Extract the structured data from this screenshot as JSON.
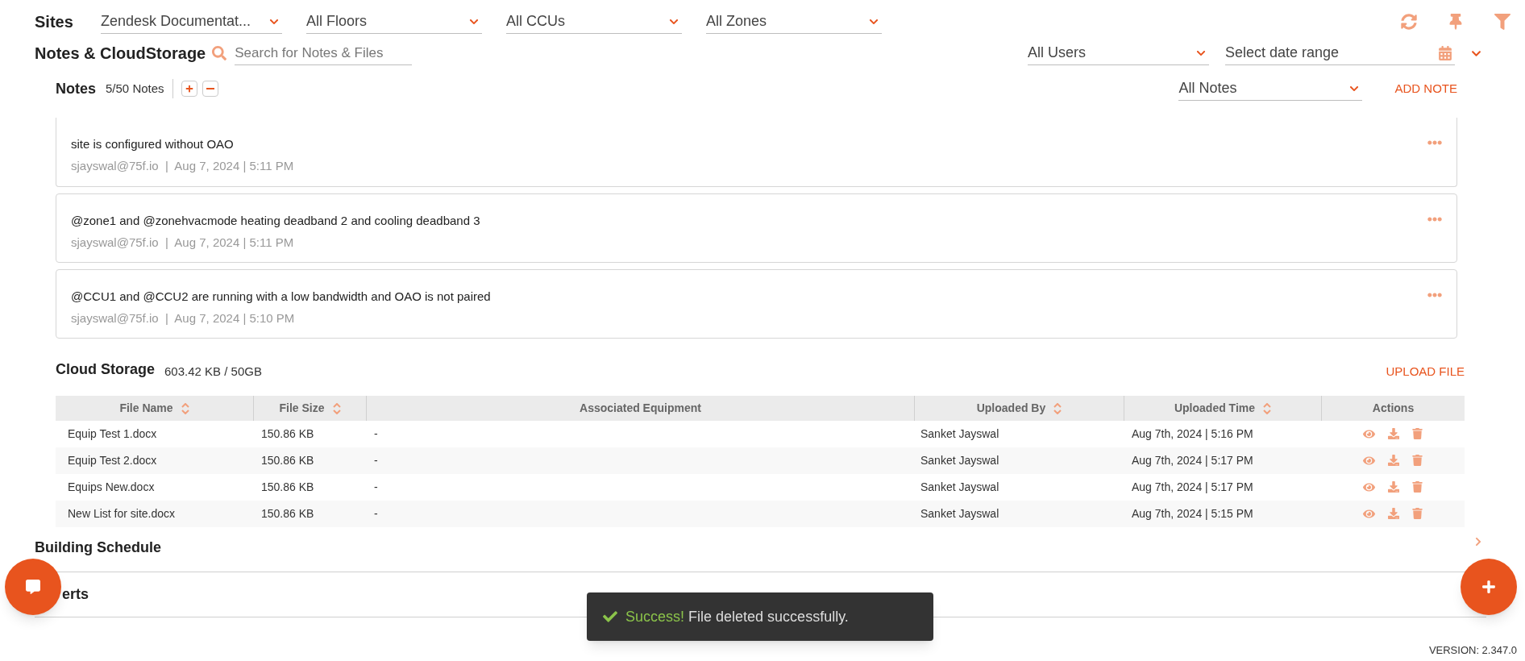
{
  "filters": {
    "title": "Sites",
    "dropdowns": [
      {
        "value": "Zendesk Documentat..."
      },
      {
        "value": "All Floors"
      },
      {
        "value": "All CCUs"
      },
      {
        "value": "All Zones"
      }
    ]
  },
  "notes_storage": {
    "title": "Notes & CloudStorage",
    "search": {
      "placeholder": "Search for Notes & Files"
    },
    "user_filter": {
      "value": "All Users"
    },
    "date_range": {
      "placeholder": "Select date range"
    }
  },
  "notes": {
    "title": "Notes",
    "count": "5/50 Notes",
    "filter": {
      "value": "All Notes"
    },
    "add_button": "ADD NOTE",
    "items": [
      {
        "text": "site is configured without OAO",
        "author": "sjayswal@75f.io",
        "separator": "|",
        "time": "Aug 7, 2024 | 5:11 PM"
      },
      {
        "text": "@zone1 and @zonehvacmode heating deadband 2 and cooling deadband 3",
        "author": "sjayswal@75f.io",
        "separator": "|",
        "time": "Aug 7, 2024 | 5:11 PM"
      },
      {
        "text": "@CCU1 and @CCU2 are running with a low bandwidth and OAO is not paired",
        "author": "sjayswal@75f.io",
        "separator": "|",
        "time": "Aug 7, 2024 | 5:10 PM"
      }
    ]
  },
  "cloud_storage": {
    "title": "Cloud Storage",
    "usage": "603.42 KB / 50GB",
    "upload_button": "UPLOAD FILE",
    "columns": [
      {
        "label": "File Name",
        "sortable": true
      },
      {
        "label": "File Size",
        "sortable": true
      },
      {
        "label": "Associated Equipment",
        "sortable": false
      },
      {
        "label": "Uploaded By",
        "sortable": true
      },
      {
        "label": "Uploaded Time",
        "sortable": true
      },
      {
        "label": "Actions",
        "sortable": false
      }
    ],
    "rows": [
      [
        "Equip Test 1.docx",
        "150.86 KB",
        "-",
        "Sanket Jayswal",
        "Aug 7th, 2024 | 5:16 PM"
      ],
      [
        "Equip Test 2.docx",
        "150.86 KB",
        "-",
        "Sanket Jayswal",
        "Aug 7th, 2024 | 5:17 PM"
      ],
      [
        "Equips New.docx",
        "150.86 KB",
        "-",
        "Sanket Jayswal",
        "Aug 7th, 2024 | 5:17 PM"
      ],
      [
        "New List for site.docx",
        "150.86 KB",
        "-",
        "Sanket Jayswal",
        "Aug 7th, 2024 | 5:15 PM"
      ]
    ]
  },
  "sections": [
    {
      "title": "Building Schedule"
    },
    {
      "title": "erts"
    }
  ],
  "toast": {
    "status": "Success!",
    "message": "File deleted successfully."
  },
  "version": "VERSION: 2.347.0"
}
